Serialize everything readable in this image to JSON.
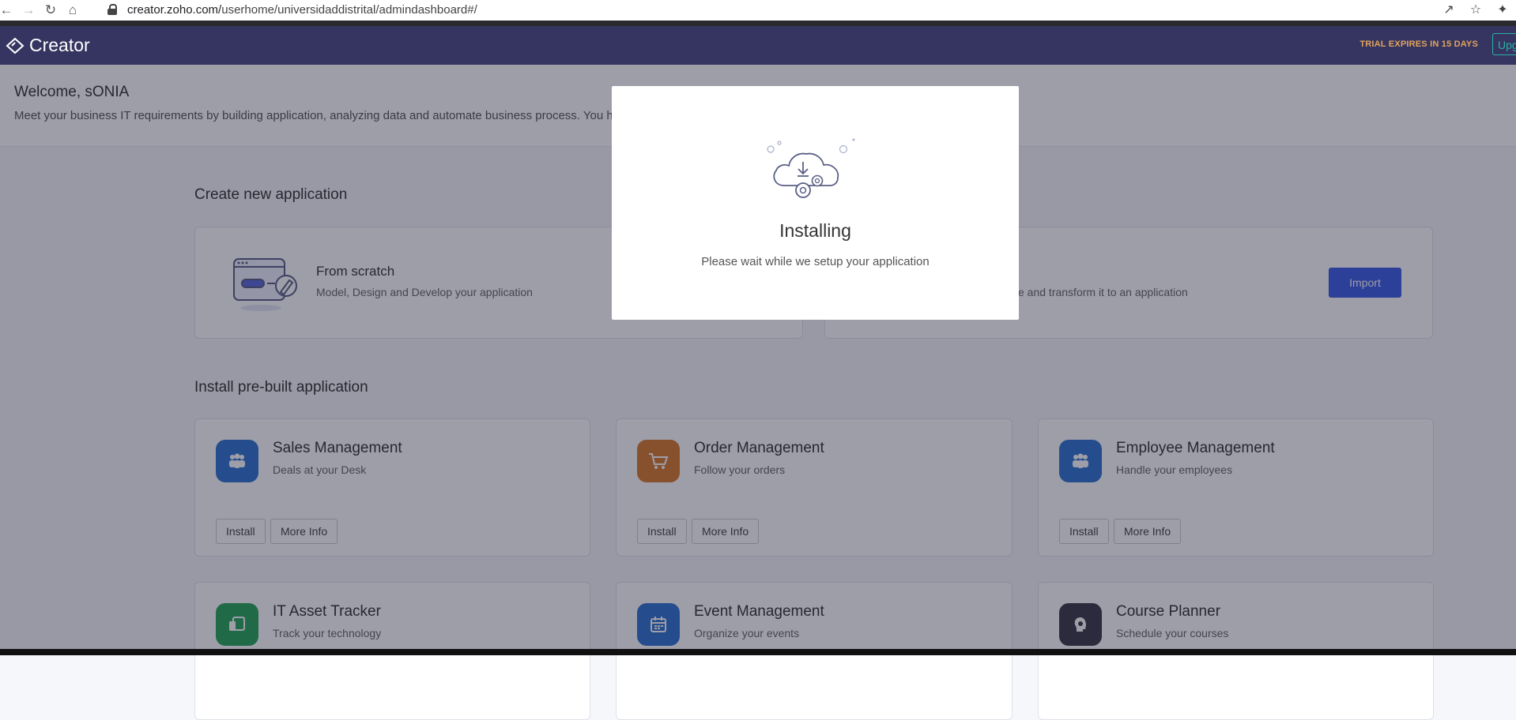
{
  "browser": {
    "url_host": "creator.zoho.com/",
    "url_path": "userhome/universidaddistrital/admindashboard#/",
    "back_icon": "arrow-left",
    "forward_icon": "arrow-right",
    "reload_icon": "reload",
    "home_icon": "home",
    "share_icon": "share",
    "star_icon": "star",
    "extensions_icon": "puzzle"
  },
  "header": {
    "app_name": "Creator",
    "trial_text": "TRIAL EXPIRES IN 15 DAYS",
    "upgrade_label": "Upg"
  },
  "welcome": {
    "title": "Welcome, sONIA",
    "subtitle": "Meet your business IT requirements by building application, analyzing data and automate business process. You ha"
  },
  "create_section": {
    "title": "Create new application",
    "scratch": {
      "title": "From scratch",
      "desc": "Model, Design and Develop your application"
    },
    "import": {
      "desc": "e and transform it to an application",
      "button": "Import"
    }
  },
  "prebuilt_section": {
    "title": "Install pre-built application",
    "install_label": "Install",
    "more_info_label": "More Info",
    "apps": [
      {
        "title": "Sales Management",
        "desc": "Deals at your Desk",
        "color": "#2f74d0",
        "icon": "people-icon"
      },
      {
        "title": "Order Management",
        "desc": "Follow your orders",
        "color": "#d77b2e",
        "icon": "cart-icon"
      },
      {
        "title": "Employee Management",
        "desc": "Handle your employees",
        "color": "#2f74d0",
        "icon": "people-icon"
      },
      {
        "title": "IT Asset Tracker",
        "desc": "Track your technology",
        "color": "#29a55a",
        "icon": "devices-icon"
      },
      {
        "title": "Event Management",
        "desc": "Organize your events",
        "color": "#2f74d0",
        "icon": "calendar-icon"
      },
      {
        "title": "Course Planner",
        "desc": "Schedule your courses",
        "color": "#3a3a48",
        "icon": "head-icon"
      }
    ]
  },
  "modal": {
    "title": "Installing",
    "subtitle": "Please wait while we setup your application"
  }
}
